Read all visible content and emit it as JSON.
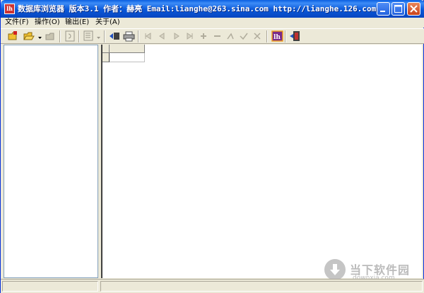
{
  "window": {
    "title": "数据库浏览器 版本3.1 作者：赫亮  Email:lianghe@263.sina.com http://lianghe.126.com",
    "app_icon_text": "lh",
    "colors": {
      "titlebar": "#0a58d8",
      "close_button": "#c9421a",
      "workspace": "#ece9d8"
    }
  },
  "menu": [
    {
      "label": "文件(F)"
    },
    {
      "label": "操作(O)"
    },
    {
      "label": "输出(E)"
    },
    {
      "label": "关于(A)"
    }
  ],
  "toolbar": {
    "icons": [
      "open-folder-icon",
      "open-dropdown-icon",
      "save-icon",
      "refresh-icon",
      "sql-icon",
      "export-icon",
      "print-icon",
      "first-record-icon",
      "prior-record-icon",
      "next-record-icon",
      "last-record-icon",
      "insert-record-icon",
      "delete-record-icon",
      "edit-record-icon",
      "post-record-icon",
      "cancel-record-icon",
      "about-logo-icon",
      "exit-icon"
    ]
  },
  "status": {
    "left": "",
    "right": ""
  },
  "watermark": {
    "main": "当下软件园",
    "sub": "downxia.com"
  }
}
